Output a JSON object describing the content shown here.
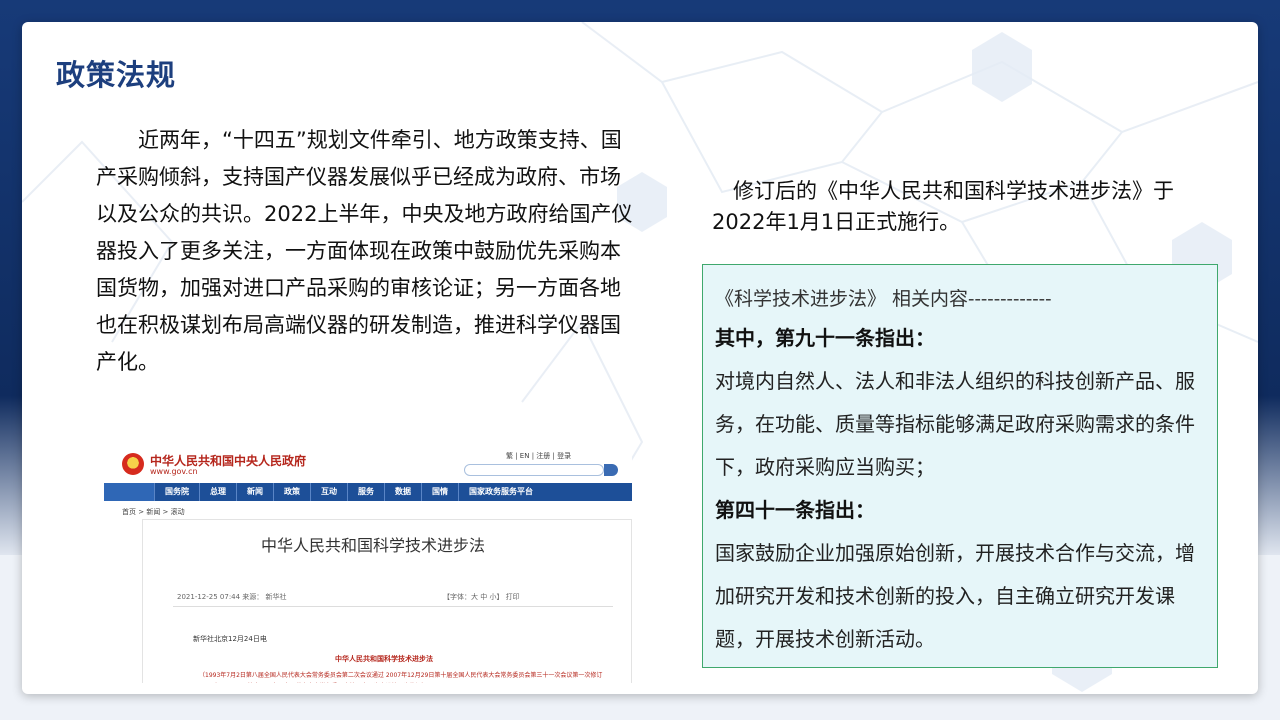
{
  "title": "政策法规",
  "paragraph": "近两年，“十四五”规划文件牵引、地方政策支持、国产采购倾斜，支持国产仪器发展似乎已经成为政府、市场以及公众的共识。2022上半年，中央及地方政府给国产仪器投入了更多关注，一方面体现在政策中鼓励优先采购本国货物，加强对进口产品采购的审核论证；另一方面各地也在积极谋划布局高端仪器的研发制造，推进科学仪器国产化。",
  "gov_screenshot": {
    "site_name": "中华人民共和国中央人民政府",
    "site_url": "www.gov.cn",
    "top_links": "繁 | EN | 注册 | 登录",
    "nav_items": [
      "国务院",
      "总理",
      "新闻",
      "政策",
      "互动",
      "服务",
      "数据",
      "国情",
      "国家政务服务平台"
    ],
    "breadcrumb": "首页 > 新闻 > 滚动",
    "article_title": "中华人民共和国科学技术进步法",
    "meta": "2021-12-25 07:44   来源： 新华社",
    "tools": "【字体：大 中 小】   打印",
    "dateline": "新华社北京12月24日电",
    "law_title": "中华人民共和国科学技术进步法",
    "note": "（1993年7月2日第八届全国人民代表大会常务委员会第二次会议通过 2007年12月29日第十届全国人民代表大会常务委员会第三十一次会议第一次修订 2021年12月24日第十三届全国人民代表大会常务委员会第三十二次会议第二次修订）"
  },
  "side_intro": "修订后的《中华人民共和国科学技术进步法》于2022年1月1日正式施行。",
  "excerpt": {
    "header": "《科学技术进步法》  相关内容-------------",
    "art91_label": "其中，第九十一条指出：",
    "art91_text": "对境内自然人、法人和非法人组织的科技创新产品、服务，在功能、质量等指标能够满足政府采购需求的条件下，政府采购应当购买；",
    "art41_label": "第四十一条指出：",
    "art41_text": "国家鼓励企业加强原始创新，开展技术合作与交流，增加研究开发和技术创新的投入，自主确立研究开发课题，开展技术创新活动。"
  },
  "colors": {
    "title": "#1d3f7e",
    "excerpt_border": "#3fa86d",
    "excerpt_bg": "#e6f6f9",
    "gov_red": "#b5261c",
    "gov_nav": "#1d4f98"
  }
}
